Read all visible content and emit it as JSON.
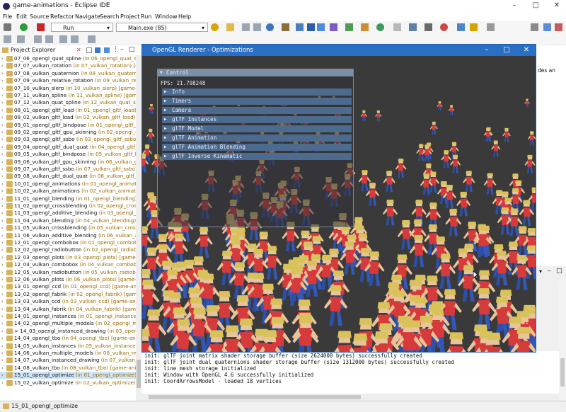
{
  "window": {
    "title": "game-animations - Eclipse IDE"
  },
  "menubar": [
    "File",
    "Edit",
    "Source",
    "Refactor",
    "Navigate",
    "Search",
    "Project",
    "Run",
    "Window",
    "Help"
  ],
  "toolbar": {
    "run_mode": "Run",
    "launch_config": "Main.exe (85)"
  },
  "project_explorer": {
    "title": "Project Explorer",
    "items": [
      {
        "name": "07_06_opengl_quat_spline",
        "loc": " (in 06_opengl_quat_spline) [game-animations]"
      },
      {
        "name": "07_07_vulkan_rotation",
        "loc": " (in 07_vulkan_rotation) [game-anim"
      },
      {
        "name": "07_08_vulkan_quaternion",
        "loc": " (in 08_vulkan_quaternion) [game"
      },
      {
        "name": "07_09_vulkan_relative_rotation",
        "loc": " (in 09_vulkan_relative_r"
      },
      {
        "name": "07_10_vulkan_slerp",
        "loc": " (in 10_vulkan_slerp) [game-animations]"
      },
      {
        "name": "07_11_vulkan_spline",
        "loc": " (in 11_vulkan_spline) [game-anim"
      },
      {
        "name": "07_12_vulkan_quat_spline",
        "loc": " (in 12_vulkan_quat_spline) [g"
      },
      {
        "name": "08_01_opengl_gltf_load",
        "loc": " (in 01_opengl_gltf_load) [game"
      },
      {
        "name": "08_02_vulkan_gltf_load",
        "loc": " (in 02_vulkan_gltf_load) [game"
      },
      {
        "name": "09_01_opengl_gltf_bindpose",
        "loc": " (in 01_opengl_gltf_bindpo"
      },
      {
        "name": "09_02_opengl_gltf_gpu_skinning",
        "loc": " (in 02_opengl_gltf_gp"
      },
      {
        "name": "09_03_opengl_gltf_ssbo",
        "loc": " (in 03_opengl_gltf_ssbo) [gam"
      },
      {
        "name": "09_04_opengl_gltf_dual_quat",
        "loc": " (in 04_opengl_gltf_dual_c"
      },
      {
        "name": "09_05_vulkan_gltf_bindpose",
        "loc": " (in 05_vulkan_gltf_bindpo"
      },
      {
        "name": "09_06_vulkan_gltf_gpu_skinning",
        "loc": " (in 06_vulkan_gltf_gpu"
      },
      {
        "name": "09_07_vulkan_gltf_ssbo",
        "loc": " (in 07_vulkan_gltf_ssbo) [gam"
      },
      {
        "name": "09_08_vulkan_gltf_dual_quat",
        "loc": " (in 08_vulkan_gltf_dual_qu"
      },
      {
        "name": "10_01_opengl_animations",
        "loc": " (in 01_opengl_animations) ["
      },
      {
        "name": "10_02_vulkan_animations",
        "loc": " (in 02_vulkan_animations) [ga"
      },
      {
        "name": "11_01_opengl_blending",
        "loc": " (in 01_opengl_blending) [game-"
      },
      {
        "name": "11_02_opengl_crossblending",
        "loc": " (in 02_opengl_crossblendin"
      },
      {
        "name": "11_03_opengl_additive_blending",
        "loc": " (in 03_opengl_additiv"
      },
      {
        "name": "11_04_vulkan_blending",
        "loc": " (in 04_vulkan_blending) [game"
      },
      {
        "name": "11_05_vulkan_crossblending",
        "loc": " (in 05_vulkan_crossblendin"
      },
      {
        "name": "11_06_vulkan_additive_blending",
        "loc": " (in 06_vulkan_additive"
      },
      {
        "name": "12_01_opengl_combobox",
        "loc": " (in 01_opengl_combobox) [game-"
      },
      {
        "name": "12_02_opengl_radiobutton",
        "loc": " (in 02_opengl_radiobutton) ["
      },
      {
        "name": "12_03_opengl_plots",
        "loc": " (in 03_opengl_plots) [game-anima"
      },
      {
        "name": "12_04_vulkan_combobox",
        "loc": " (in 04_vulkan_combobox) [game-"
      },
      {
        "name": "12_05_vulkan_radiobutton",
        "loc": " (in 05_vulkan_radiobutton) ["
      },
      {
        "name": "12_06_vulkan_plots",
        "loc": " (in 06_vulkan_plots) [game-anima"
      },
      {
        "name": "13_01_opengl_ccd",
        "loc": " (in 01_opengl_ccd) [game-animations]"
      },
      {
        "name": "13_02_opengl_fabrik",
        "loc": " (in 02_opengl_fabrik) [game-anim"
      },
      {
        "name": "13_03_vulkan_ccd",
        "loc": " (in 03_vulkan_ccd) [game-animations"
      },
      {
        "name": "13_04_vulkan_fabrik",
        "loc": " (in 04_vulkan_fabrik) [game-anim"
      },
      {
        "name": "14_01_opengl_instances",
        "loc": " (in 01_opengl_instances) [gam"
      },
      {
        "name": "14_02_opengl_multiple_models",
        "loc": " (in 02_opengl_multiple"
      },
      {
        "name": "> 14_03_opengl_instanced_drawing",
        "loc": " (in 03_opengl_inst"
      },
      {
        "name": "14_04_opengl_tbo",
        "loc": " (in 04_opengl_tbo) [game-animati"
      },
      {
        "name": "14_05_vulkan_instances",
        "loc": " (in 05_vulkan_instances) [gam"
      },
      {
        "name": "14_06_vulkan_multiple_models",
        "loc": " (in 06_vulkan_multiple"
      },
      {
        "name": "14_07_vulkan_instanced_drawing",
        "loc": " (in 07_vulkan_instan"
      },
      {
        "name": "14_08_vulkan_tbo",
        "loc": " (in 08_vulkan_tbo) [game-animati"
      },
      {
        "name": "15_01_opengl_optimize",
        "loc": " (in 01_opengl_optimize) [gam"
      },
      {
        "name": "15_02_vulkan_optimize",
        "loc": " (in 02_vulkan_optimize) [gam"
      }
    ]
  },
  "status": {
    "selected": "15_01_opengl_optimize"
  },
  "editor_fragment": "des an",
  "console": {
    "lines": [
      "init: glTF joint matrix shader storage buffer (size 2624000 bytes) successfully created",
      "init: glTF joint dual quaternions shader storage buffer (size 1312000 bytes) successfully created",
      "init: line mesh storage initialized",
      "init: Window with OpenGL 4.6 successfully initialized",
      "init: CoordArrowsModel - loaded 18 vertices"
    ]
  },
  "gl_window": {
    "title": "OpenGL Renderer - Optimizations",
    "panel": {
      "header": "Control",
      "fps": "FPS: 21.798248",
      "sections": [
        "Info",
        "Timers",
        "Camera",
        "glTF Instances",
        "glTF Model",
        "glTF Animation",
        "glTF Animation Blending",
        "glTF Inverse Kinematic"
      ]
    }
  },
  "colors": {
    "gl_title": "#2b6fc4",
    "panel_section": "#4d6a8f",
    "selected_row": "#cde3f7"
  }
}
